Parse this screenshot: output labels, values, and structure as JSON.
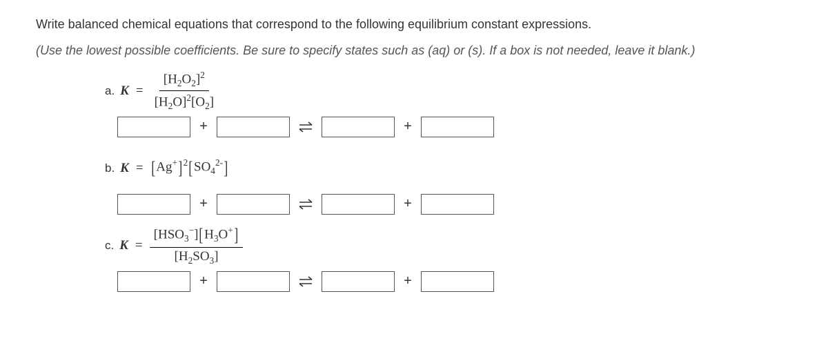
{
  "intro": "Write balanced chemical equations that correspond to the following equilibrium constant expressions.",
  "hint": "(Use the lowest possible coefficients. Be sure to specify states such as (aq) or (s). If a box is not needed, leave it blank.)",
  "labels": {
    "a": "a.",
    "b": "b.",
    "c": "c.",
    "K": "K",
    "eq": "=",
    "plus": "+"
  },
  "chart_data": [
    {
      "type": "table",
      "title": "Equilibrium constant expression a",
      "numerator": [
        {
          "species": "H2O2",
          "power": 2
        }
      ],
      "denominator": [
        {
          "species": "H2O",
          "power": 2
        },
        {
          "species": "O2",
          "power": 1
        }
      ]
    },
    {
      "type": "table",
      "title": "Equilibrium constant expression b",
      "numerator": [
        {
          "species": "Ag+",
          "power": 2
        },
        {
          "species": "SO4^2-",
          "power": 1
        }
      ],
      "denominator": []
    },
    {
      "type": "table",
      "title": "Equilibrium constant expression c",
      "numerator": [
        {
          "species": "HSO3-",
          "power": 1
        },
        {
          "species": "H3O+",
          "power": 1
        }
      ],
      "denominator": [
        {
          "species": "H2SO3",
          "power": 1
        }
      ]
    }
  ]
}
